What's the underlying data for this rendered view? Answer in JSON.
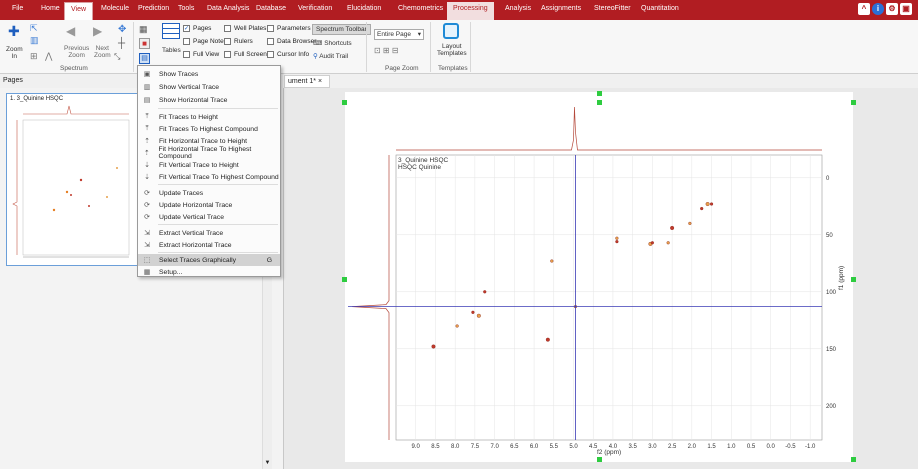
{
  "menubar": {
    "items": [
      "File",
      "Home",
      "View",
      "Molecule",
      "Prediction",
      "Tools",
      "Data Analysis",
      "Database",
      "Verification",
      "Elucidation",
      "Chemometrics",
      "Processing",
      "Analysis",
      "Assignments",
      "StereoFitter",
      "Quantitation"
    ],
    "active": "View"
  },
  "ribbon": {
    "zoom_in": "Zoom\nIn",
    "previous_zoom": "Previous\nZoom",
    "next_zoom": "Next\nZoom",
    "group_spectrum": "Spectrum",
    "tables": "Tables",
    "pages": "Pages",
    "page_notes": "Page Notes",
    "full_view": "Full View",
    "well_plates": "Well Plates",
    "rulers": "Rulers",
    "full_screen": "Full Screen",
    "parameters": "Parameters",
    "data_browser": "Data Browser",
    "cursor_info": "Cursor Info",
    "spectrum_toolbar": "Spectrum Toolbar",
    "shortcuts": "Shortcuts",
    "audit_trail": "Audit Trail",
    "page_zoom_value": "Entire Page",
    "group_page_zoom": "Page Zoom",
    "layout_templates": "Layout\nTemplates",
    "group_templates": "Templates"
  },
  "pages_pane": {
    "title": "Pages",
    "thumb_title": "1. 3_Quinine HSQC"
  },
  "document_tab": {
    "label": "ument 1*",
    "close": "×"
  },
  "dropdown": {
    "items": [
      {
        "label": "Show Traces",
        "icon": "show-traces-icon"
      },
      {
        "label": "Show Vertical Trace",
        "icon": "vertical-trace-icon"
      },
      {
        "label": "Show Horizontal Trace",
        "icon": "horizontal-trace-icon"
      },
      {
        "label": "Fit Traces to Height",
        "icon": "fit-height-icon"
      },
      {
        "label": "Fit Traces To Highest Compound",
        "icon": "fit-compound-icon"
      },
      {
        "label": "Fit Horizontal Trace to Height",
        "icon": "fit-h-height-icon"
      },
      {
        "label": "Fit Horizontal Trace To Highest Compound",
        "icon": "fit-h-compound-icon"
      },
      {
        "label": "Fit Vertical Trace to Height",
        "icon": "fit-v-height-icon"
      },
      {
        "label": "Fit Vertical Trace To Highest Compound",
        "icon": "fit-v-compound-icon"
      },
      {
        "label": "Update Traces",
        "icon": "update-traces-icon"
      },
      {
        "label": "Update Horizontal Trace",
        "icon": "update-h-icon"
      },
      {
        "label": "Update Vertical Trace",
        "icon": "update-v-icon"
      },
      {
        "label": "Extract Vertical Trace",
        "icon": "extract-v-icon"
      },
      {
        "label": "Extract Horizontal Trace",
        "icon": "extract-h-icon"
      },
      {
        "label": "Select Traces Graphically",
        "icon": "select-graphically-icon",
        "shortcut": "G",
        "selected": true
      },
      {
        "label": "Setup...",
        "icon": "setup-icon"
      }
    ]
  },
  "spectrum": {
    "title_line1": "3_Quinine HSQC",
    "title_line2": "HSQC Quinine",
    "x_axis_label": "f2 (ppm)",
    "y_axis_label": "f1 (ppm)",
    "x_ticks": [
      "9.0",
      "8.5",
      "8.0",
      "7.5",
      "7.0",
      "6.5",
      "6.0",
      "5.5",
      "5.0",
      "4.5",
      "4.0",
      "3.5",
      "3.0",
      "2.5",
      "2.0",
      "1.5",
      "1.0",
      "0.5",
      "0.0",
      "-0.5",
      "-1.0"
    ],
    "y_ticks": [
      "0",
      "50",
      "100",
      "150",
      "200"
    ],
    "x_range": [
      9.5,
      -1.3
    ],
    "y_range": [
      -20,
      230
    ],
    "cursor": {
      "x": 4.95,
      "y": 113
    }
  }
}
